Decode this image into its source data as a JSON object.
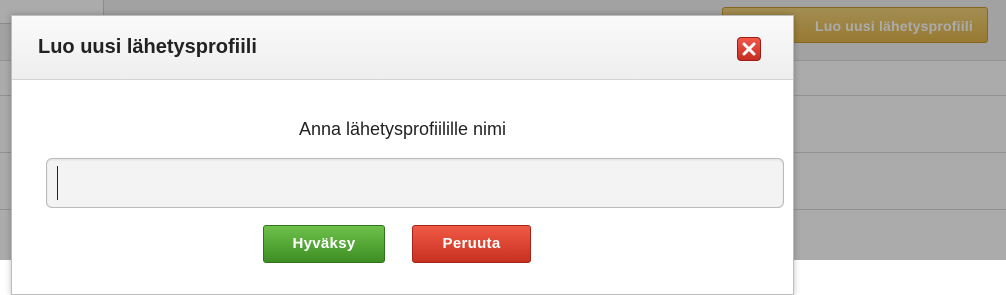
{
  "background": {
    "new_profile_button_label": "Luo uusi lähetysprofiili"
  },
  "dialog": {
    "title": "Luo uusi lähetysprofiili",
    "close_icon": "close-icon",
    "prompt": "Anna lähetysprofiilille nimi",
    "input": {
      "value": "",
      "placeholder": ""
    },
    "accept_label": "Hyväksy",
    "cancel_label": "Peruuta"
  },
  "colors": {
    "accept": "#4ea632",
    "cancel": "#dd4332",
    "close": "#d9382c",
    "background_button": "#e8c05c"
  }
}
